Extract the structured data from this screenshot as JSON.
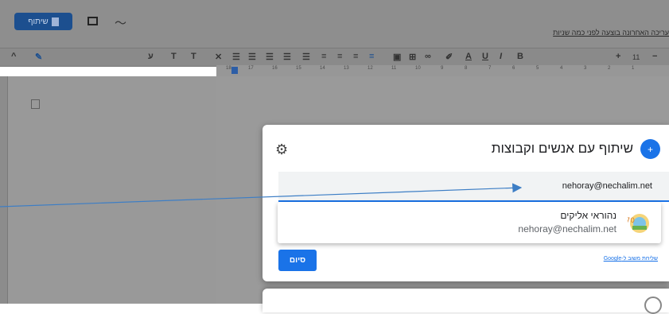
{
  "header": {
    "share_button_label": "שיתוף",
    "last_edit_text": "עריכה האחרונה בוצעה לפני כמה שניות",
    "icons": [
      "docs-icon",
      "comment-icon",
      "activity-trend-icon"
    ]
  },
  "toolbar": {
    "items": [
      "^",
      "✎",
      "ע",
      "T",
      "T",
      "✕",
      "☰",
      "☰",
      "☰",
      "☰",
      "☰",
      "≡",
      "≡",
      "≡",
      "≡",
      "▣",
      "⊞",
      "∞",
      "✐",
      "A",
      "U",
      "I",
      "B",
      "+",
      "11",
      "−"
    ],
    "font_size": "11"
  },
  "ruler": {
    "numbers": [
      "18",
      "17",
      "16",
      "15",
      "14",
      "13",
      "12",
      "11",
      "10",
      "9",
      "8",
      "7",
      "6",
      "5",
      "4",
      "3",
      "2",
      "1"
    ]
  },
  "dialog": {
    "title": "שיתוף עם אנשים וקבוצות",
    "email_value": "nehoray@nechalim.net",
    "suggestion": {
      "name": "נהוראי אליקים",
      "email": "nehoray@nechalim.net"
    },
    "done_label": "סיום",
    "feedback_link": "שליחת משוב ל-Google"
  },
  "colors": {
    "accent": "#1a73e8",
    "dim_overlay": "#8e8e8e",
    "arrow": "#3d7ec5"
  }
}
